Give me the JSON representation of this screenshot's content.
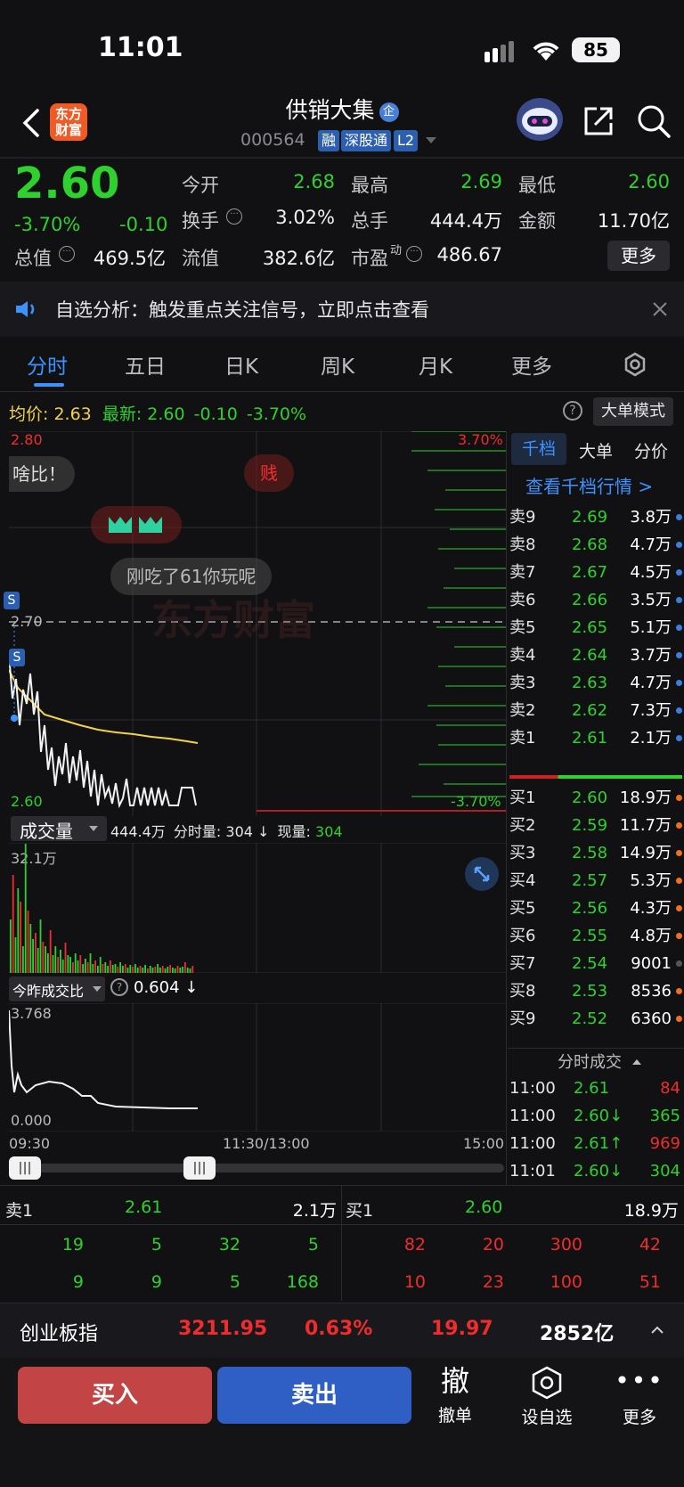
{
  "status_bar": {
    "time": "11:01",
    "battery": "85"
  },
  "header": {
    "title": "供销大集",
    "title_badge": "企",
    "code": "000564",
    "tags": [
      "融",
      "深股通",
      "L2"
    ],
    "logo_line1": "东方",
    "logo_line2": "财富"
  },
  "quote": {
    "price": "2.60",
    "change_pct": "-3.70%",
    "change": "-0.10",
    "today_open_label": "今开",
    "today_open": "2.68",
    "high_label": "最高",
    "high": "2.69",
    "low_label": "最低",
    "low": "2.60",
    "turnover_label": "换手",
    "turnover": "3.02%",
    "total_hands_label": "总手",
    "total_hands": "444.4万",
    "amount_label": "金额",
    "amount": "11.70亿",
    "total_value_label": "总值",
    "total_value": "469.5亿",
    "float_value_label": "流值",
    "float_value": "382.6亿",
    "pe_label": "市盈",
    "pe_sup": "动",
    "pe": "486.67",
    "more_button": "更多"
  },
  "notice": {
    "text": "自选分析：触发重点关注信号，立即点击查看"
  },
  "tabs": [
    "分时",
    "五日",
    "日K",
    "周K",
    "月K",
    "更多"
  ],
  "summary": {
    "avg_label": "均价:",
    "avg": "2.63",
    "latest_label": "最新:",
    "latest": "2.60",
    "latest_change": "-0.10",
    "latest_pct": "-3.70%",
    "big_order_mode": "大单模式"
  },
  "chart_labels": {
    "top_price": "2.80",
    "bottom_price": "2.60",
    "mid_price": "2.70",
    "top_pct": "3.70%",
    "bottom_pct": "-3.70%",
    "danmaku_1": "啥比！",
    "danmaku_2": "贱",
    "danmaku_3": "刚吃了61你玩呢",
    "watermark": "东方财富",
    "s_marker": "S"
  },
  "volume": {
    "selector": "成交量",
    "total": "444.4万",
    "fenshi_label": "分时量:",
    "fenshi": "304 ↓",
    "now_label": "现量:",
    "now": "304",
    "max_label": "32.1万"
  },
  "ratio": {
    "selector": "今昨成交比",
    "value": "0.604 ↓",
    "max": "3.768",
    "min": "0.000"
  },
  "time_axis": [
    "09:30",
    "11:30/13:00",
    "15:00"
  ],
  "order_book": {
    "tabs": [
      "千档",
      "大单",
      "分价"
    ],
    "link": "查看千档行情 >",
    "asks": [
      {
        "label": "卖9",
        "price": "2.69",
        "vol": "3.8万"
      },
      {
        "label": "卖8",
        "price": "2.68",
        "vol": "4.7万"
      },
      {
        "label": "卖7",
        "price": "2.67",
        "vol": "4.5万"
      },
      {
        "label": "卖6",
        "price": "2.66",
        "vol": "3.5万"
      },
      {
        "label": "卖5",
        "price": "2.65",
        "vol": "5.1万"
      },
      {
        "label": "卖4",
        "price": "2.64",
        "vol": "3.7万"
      },
      {
        "label": "卖3",
        "price": "2.63",
        "vol": "4.7万"
      },
      {
        "label": "卖2",
        "price": "2.62",
        "vol": "7.3万"
      },
      {
        "label": "卖1",
        "price": "2.61",
        "vol": "2.1万"
      }
    ],
    "bids": [
      {
        "label": "买1",
        "price": "2.60",
        "vol": "18.9万"
      },
      {
        "label": "买2",
        "price": "2.59",
        "vol": "11.7万"
      },
      {
        "label": "买3",
        "price": "2.58",
        "vol": "14.9万"
      },
      {
        "label": "买4",
        "price": "2.57",
        "vol": "5.3万"
      },
      {
        "label": "买5",
        "price": "2.56",
        "vol": "4.3万"
      },
      {
        "label": "买6",
        "price": "2.55",
        "vol": "4.8万"
      },
      {
        "label": "买7",
        "price": "2.54",
        "vol": "9001"
      },
      {
        "label": "买8",
        "price": "2.53",
        "vol": "8536"
      },
      {
        "label": "买9",
        "price": "2.52",
        "vol": "6360"
      }
    ],
    "ticks_title": "分时成交",
    "ticks": [
      {
        "time": "11:00",
        "price": "2.61",
        "vol": "84"
      },
      {
        "time": "11:00",
        "price": "2.60↓",
        "vol": "365"
      },
      {
        "time": "11:00",
        "price": "2.61↑",
        "vol": "969"
      },
      {
        "time": "11:01",
        "price": "2.60↓",
        "vol": "304"
      }
    ]
  },
  "level1": {
    "sell_label": "卖1",
    "sell_price": "2.61",
    "sell_vol": "2.1万",
    "buy_label": "买1",
    "buy_price": "2.60",
    "buy_vol": "18.9万",
    "sell_queue": [
      [
        "19",
        "5",
        "32",
        "5"
      ],
      [
        "9",
        "9",
        "5",
        "168"
      ]
    ],
    "buy_queue": [
      [
        "82",
        "20",
        "300",
        "42"
      ],
      [
        "10",
        "23",
        "100",
        "51"
      ]
    ]
  },
  "index_bar": {
    "name": "创业板指",
    "value": "3211.95",
    "pct": "0.63%",
    "change": "19.97",
    "amount": "2852亿"
  },
  "bottom": {
    "buy": "买入",
    "sell": "卖出",
    "cancel_icon": "撤",
    "cancel": "撤单",
    "set_watch": "设自选",
    "more": "更多"
  },
  "colors": {
    "up": "#f02c2c",
    "down": "#2fd12f",
    "avg_line": "#f2d24a",
    "accent": "#3b93ff"
  }
}
